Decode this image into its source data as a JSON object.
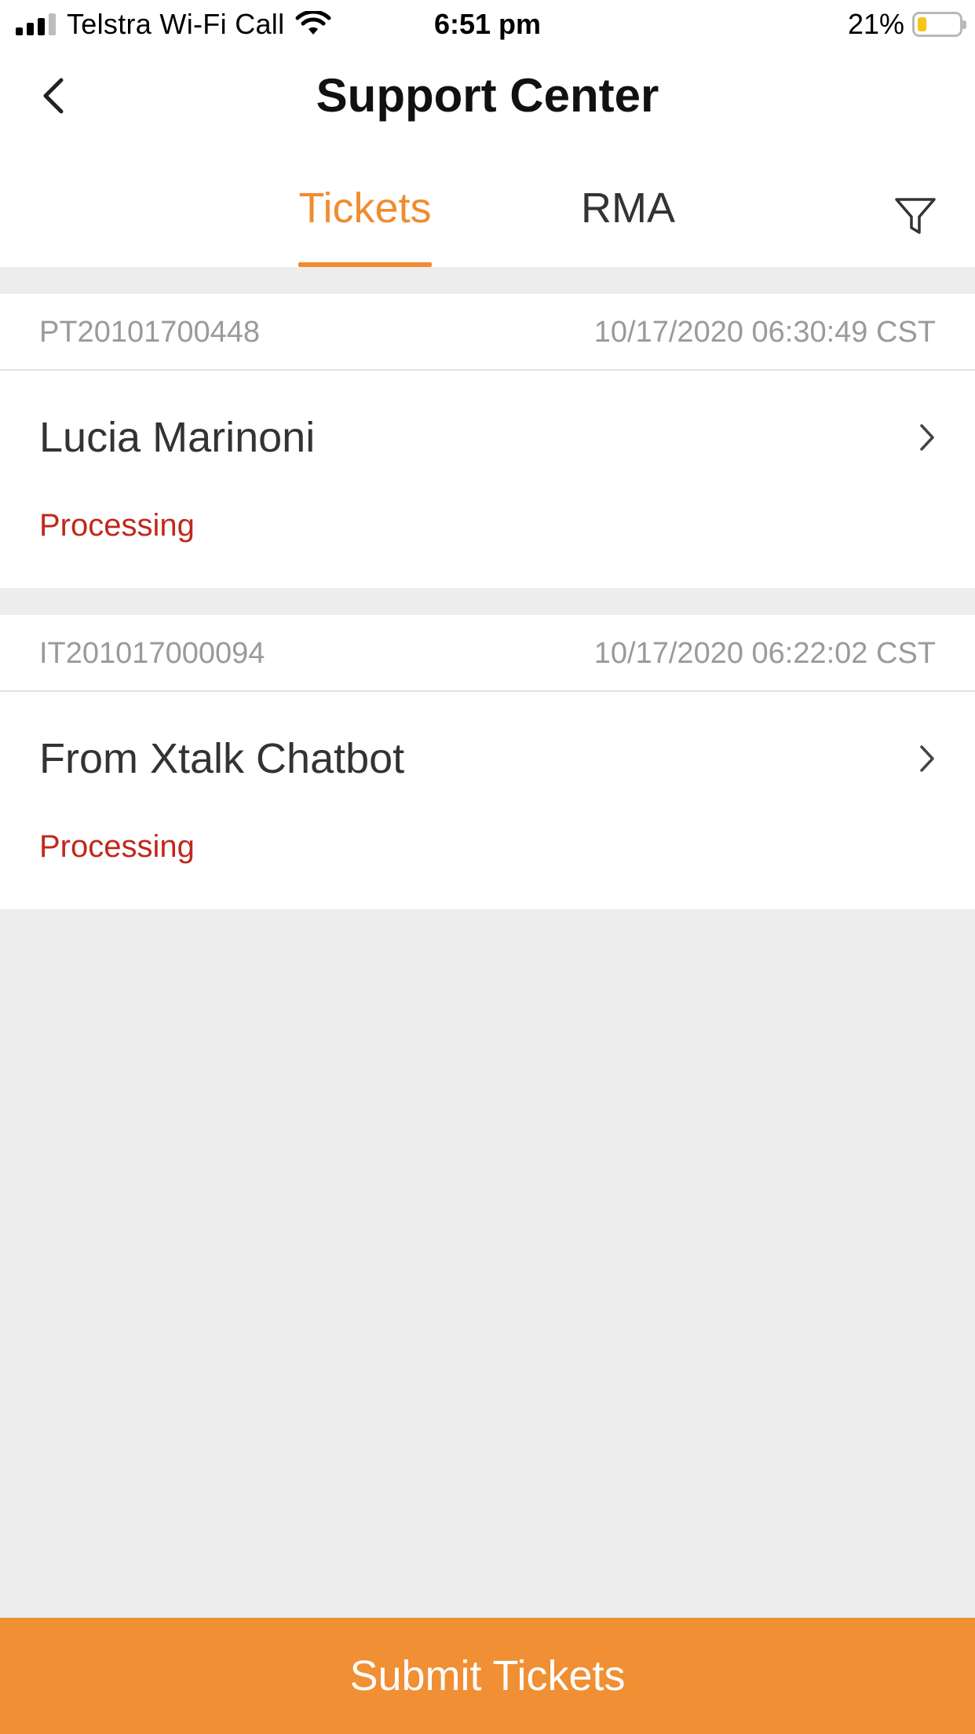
{
  "status_bar": {
    "carrier": "Telstra Wi-Fi Call",
    "time": "6:51 pm",
    "battery_percent": "21%",
    "battery_level": 0.21,
    "icons": [
      "signal-icon",
      "wifi-icon",
      "battery-icon"
    ]
  },
  "nav": {
    "title": "Support Center",
    "back_icon": "chevron-left-icon"
  },
  "tabs": [
    {
      "label": "Tickets",
      "active": true
    },
    {
      "label": "RMA",
      "active": false
    }
  ],
  "filter_icon": "filter-icon",
  "tickets": [
    {
      "id": "PT20101700448",
      "time": "10/17/2020 06:30:49 CST",
      "title": "Lucia Marinoni",
      "status": "Processing"
    },
    {
      "id": "IT201017000094",
      "time": "10/17/2020 06:22:02 CST",
      "title": "From Xtalk Chatbot",
      "status": "Processing"
    }
  ],
  "submit_label": "Submit Tickets",
  "colors": {
    "accent": "#f08c30",
    "status_processing": "#c0281c",
    "background": "#ededed"
  }
}
